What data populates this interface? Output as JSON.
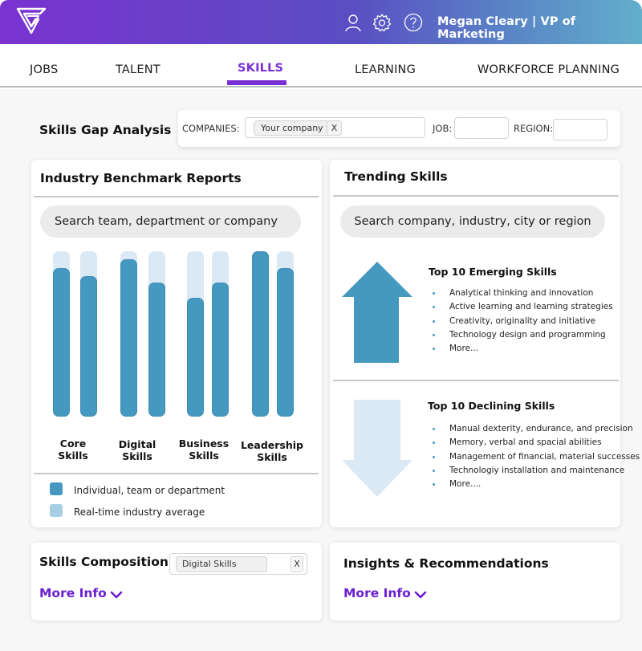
{
  "header": {
    "user_label": "Megan Cleary | VP of Marketing",
    "icons": [
      "user-icon",
      "gear-icon",
      "help-icon"
    ],
    "gradient_colors": [
      "#7a32d0",
      "#62aecb"
    ]
  },
  "nav": {
    "tabs": [
      {
        "label": "JOBS",
        "active": false
      },
      {
        "label": "TALENT",
        "active": false
      },
      {
        "label": "SKILLS",
        "active": true
      },
      {
        "label": "LEARNING",
        "active": false
      },
      {
        "label": "WORKFORCE PLANNING",
        "active": false
      }
    ],
    "accent_color": "#7a2fd6"
  },
  "gap_analysis": {
    "title": "Skills Gap Analysis",
    "companies_label": "COMPANIES:",
    "companies_chip": "Your company",
    "chip_remove": "X",
    "job_label": "JOB:",
    "job_value": "",
    "region_label": "REGION:",
    "region_value": ""
  },
  "benchmark": {
    "title": "Industry Benchmark Reports",
    "search_placeholder": "Search team, department or company",
    "legend": [
      {
        "label": "Individual, team or department",
        "color": "#4599c1"
      },
      {
        "label": "Real-time industry average",
        "color": "#a7cfe3"
      }
    ]
  },
  "chart_data": {
    "type": "bar",
    "categories": [
      "Core Skills",
      "Digital Skills",
      "Business Skills",
      "Leadership Skills"
    ],
    "category_lines": [
      [
        "Core",
        "Skills"
      ],
      [
        "Digital",
        "Skills"
      ],
      [
        "Business",
        "Skills"
      ],
      [
        "Leadership",
        "Skills"
      ]
    ],
    "series": [
      {
        "name": "Individual, team or department (bar 1)",
        "values": [
          90,
          95,
          72,
          100
        ]
      },
      {
        "name": "Individual, team or department (bar 2)",
        "values": [
          85,
          81,
          81,
          90
        ]
      },
      {
        "name": "Real-time industry average",
        "values": [
          100,
          100,
          100,
          100
        ]
      }
    ],
    "ylim": [
      0,
      100
    ],
    "title": "",
    "xlabel": "",
    "ylabel": "",
    "grid": false,
    "legend_position": "bottom"
  },
  "trending": {
    "title": "Trending Skills",
    "search_placeholder": "Search company, industry, city or region",
    "emerging": {
      "title": "Top 10 Emerging Skills",
      "items": [
        "Analytical thinking and innovation",
        "Active learning and learning strategies",
        "Creativity, originality and initiative",
        "Technology design and programming",
        "More..."
      ],
      "arrow_color": "#4599c1"
    },
    "declining": {
      "title": "Top 10 Declining Skills",
      "items": [
        "Manual dexterity, endurance, and precision",
        "Memory, verbal and spacial abilities",
        "Management of financial, material successes",
        "Technologiy installation and maintenance",
        "More...."
      ],
      "arrow_color": "#dbe9f4"
    }
  },
  "composition": {
    "title": "Skills Composition",
    "chip": "Digital Skills",
    "chip_remove": "X",
    "more_info": "More Info"
  },
  "insights": {
    "title": "Insights & Recommendations",
    "more_info": "More Info"
  }
}
